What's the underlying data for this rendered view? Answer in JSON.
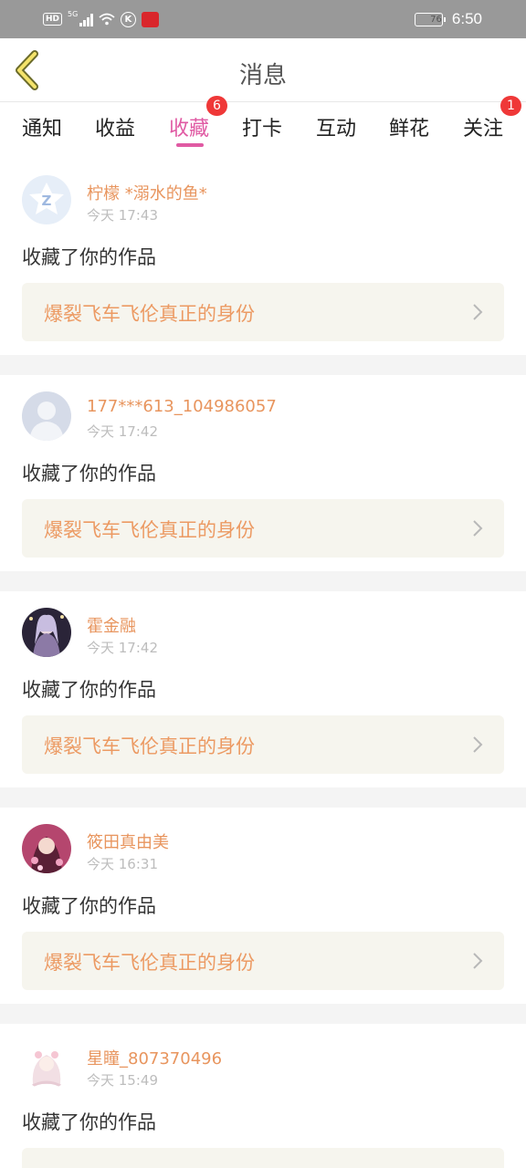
{
  "status_bar": {
    "hd": "HD",
    "network": "5G",
    "k_icon": "K",
    "battery": "76",
    "battery_level": 0.76,
    "time": "6:50"
  },
  "header": {
    "title": "消息"
  },
  "tabs": [
    {
      "label": "通知",
      "active": false
    },
    {
      "label": "收益",
      "active": false
    },
    {
      "label": "收藏",
      "active": true,
      "badge": "6"
    },
    {
      "label": "打卡",
      "active": false
    },
    {
      "label": "互动",
      "active": false
    },
    {
      "label": "鲜花",
      "active": false
    },
    {
      "label": "关注",
      "active": false,
      "badge": "1"
    }
  ],
  "colors": {
    "accent": "#e05aa3",
    "username": "#e8955e",
    "work_title": "#ec9a63",
    "badge": "#ef3838"
  },
  "feed": [
    {
      "user": "柠檬 *溺水的鱼*",
      "time": "今天 17:43",
      "action": "收藏了你的作品",
      "work": "爆裂飞车飞伦真正的身份",
      "avatar": "default-logo-avatar"
    },
    {
      "user": "177***613_104986057",
      "time": "今天 17:42",
      "action": "收藏了你的作品",
      "work": "爆裂飞车飞伦真正的身份",
      "avatar": "default-person-avatar"
    },
    {
      "user": "霍金融",
      "time": "今天 17:42",
      "action": "收藏了你的作品",
      "work": "爆裂飞车飞伦真正的身份",
      "avatar": "anime-avatar-dark"
    },
    {
      "user": "筱田真由美",
      "time": "今天 16:31",
      "action": "收藏了你的作品",
      "work": "爆裂飞车飞伦真正的身份",
      "avatar": "anime-avatar-pink"
    },
    {
      "user": "星瞳_807370496",
      "time": "今天 15:49",
      "action": "收藏了你的作品",
      "work": "",
      "avatar": "anime-avatar-light"
    }
  ]
}
